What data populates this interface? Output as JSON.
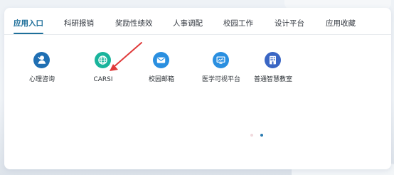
{
  "tabs": [
    {
      "label": "应用入口",
      "active": true
    },
    {
      "label": "科研报销",
      "active": false
    },
    {
      "label": "奖励性绩效",
      "active": false
    },
    {
      "label": "人事调配",
      "active": false
    },
    {
      "label": "校园工作",
      "active": false
    },
    {
      "label": "设计平台",
      "active": false
    },
    {
      "label": "应用收藏",
      "active": false
    }
  ],
  "apps": [
    {
      "label": "心理咨询",
      "icon": "user-counsel-icon",
      "color": "#1f6fb3"
    },
    {
      "label": "CARSI",
      "icon": "globe-icon",
      "color": "#19b49c"
    },
    {
      "label": "校园邮箱",
      "icon": "mail-icon",
      "color": "#2a8fe0"
    },
    {
      "label": "医学可视平台",
      "icon": "monitor-icon",
      "color": "#2a8fe0"
    },
    {
      "label": "普通智慧教室",
      "icon": "classroom-building-icon",
      "color": "#3a66c4"
    }
  ],
  "pagination": {
    "pages": 2,
    "current": 2
  },
  "colors": {
    "accent": "#1e6f9a",
    "annotation_arrow": "#e03a3a",
    "dot_inactive": "#f1d9dd",
    "dot_active": "#2a7bb0"
  }
}
